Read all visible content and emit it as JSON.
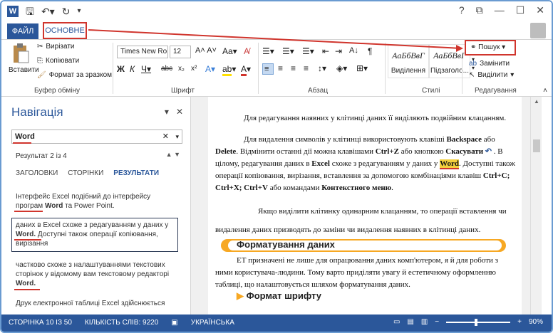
{
  "app": {
    "qat_icons": [
      "word-logo",
      "save-icon",
      "undo-icon",
      "redo-icon",
      "customize-icon"
    ],
    "window_controls": [
      "?",
      "⧉",
      "—",
      "☐",
      "✕"
    ]
  },
  "tabs": {
    "file": "ФАЙЛ",
    "home": "ОСНОВНЕ"
  },
  "ribbon": {
    "clipboard": {
      "paste": "Вставити",
      "cut": "Вирізати",
      "copy": "Копіювати",
      "format_painter": "Формат за зразком",
      "label": "Буфер обміну"
    },
    "font": {
      "family": "Times New Ro",
      "size": "12",
      "label": "Шрифт"
    },
    "paragraph": {
      "label": "Абзац"
    },
    "styles": {
      "items": [
        {
          "sample": "АаБбВвГ",
          "label": "Виділення"
        },
        {
          "sample": "АаБбВвГ",
          "label": "Підзаголо..."
        }
      ],
      "label": "Стилі"
    },
    "editing": {
      "search": "Пошук",
      "replace": "Замінити",
      "select": "Виділити",
      "label": "Редагування"
    }
  },
  "nav": {
    "title": "Навігація",
    "search_value": "Word",
    "result": "Результат 2 із 4",
    "tabs": [
      "ЗАГОЛОВКИ",
      "СТОРІНКИ",
      "РЕЗУЛЬТАТИ"
    ],
    "results": [
      {
        "pre": "Інтерфейс Excel подібний до інтерфейсу програм ",
        "hit": "Word",
        "post": " та Power Point."
      },
      {
        "pre": "даних в Excel схоже з редагуванням у даних у ",
        "hit": "Word.",
        "post": " Доступні також операції копіювання, вирізання"
      },
      {
        "pre": "частково схоже з налаштуваннями текстових сторінок у відомому вам текстовому редакторі ",
        "hit": "Word.",
        "post": ""
      },
      {
        "pre": "Друк електронної таблиці Excel здійснюється",
        "hit": "",
        "post": ""
      }
    ]
  },
  "doc": {
    "p1": "Для редагування наявних у клітинці даних її виділяють подвійним клацанням.",
    "p2a": "Для видалення символів у клітинці використовують клавіші ",
    "p2b": "Backspace",
    "p2c": " або ",
    "p2d": "Delete",
    "p2e": ". Відмінити останні дії можна клавішами ",
    "p2f": "Ctrl+Z",
    "p2g": " або кнопкою ",
    "p2h": "Скасувати",
    "p2i": " . В цілому, редагування даних в ",
    "p2j": "Excel",
    "p2k": " схоже з редагуванням у даних у ",
    "p2l": "Word",
    "p2m": ". Доступні також операції копіювання, вирізання, вставлення за допомогою комбінаціями клавіш ",
    "p2n": "Ctrl+C; Ctrl+X; Ctrl+V",
    "p2o": " або командами ",
    "p2p": "Контекстного меню",
    "p3": "Якщо виділити клітинку одинарним клацанням, то операції вставлення чи видалення даних призводять до заміни чи видалення наявних в клітинці даних.",
    "heading": "Форматування даних",
    "p4": "ЕТ призначені не лише для опрацювання даних комп'ютером, я й для роботи з ними користувача-людини. Тому варто приділяти увагу й естетичному оформленню таблиці, що налаштовується шляхом форматування даних.",
    "subheading": "Формат шрифту"
  },
  "status": {
    "page": "СТОРІНКА 10 ІЗ 50",
    "words": "КІЛЬКІСТЬ СЛІВ: 9220",
    "lang": "УКРАЇНСЬКА",
    "zoom": "90%"
  },
  "colors": {
    "accent": "#2b579a",
    "annotation": "#d0352d",
    "heading_bar": "#f7a823"
  }
}
